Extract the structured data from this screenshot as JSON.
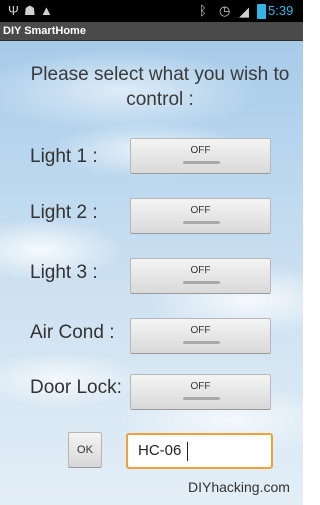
{
  "status_bar": {
    "icons": [
      "usb-icon",
      "android-debug-icon",
      "warning-icon",
      "bluetooth-icon",
      "alarm-icon",
      "signal-icon",
      "battery-icon"
    ],
    "time": "5:39",
    "accent_color": "#33b5e5"
  },
  "app": {
    "title": "DIY SmartHome"
  },
  "prompt": "Please select what you wish to control :",
  "devices": [
    {
      "label": "Light 1 :",
      "state": "OFF"
    },
    {
      "label": "Light 2 :",
      "state": "OFF"
    },
    {
      "label": "Light 3 :",
      "state": "OFF"
    },
    {
      "label": "Air Cond :",
      "state": "OFF"
    },
    {
      "label": "Door Lock:",
      "state": "OFF"
    }
  ],
  "bluetooth": {
    "ok_label": "OK",
    "device_name": "HC-06",
    "field_border_color": "#f0a23a"
  },
  "watermark": "DIYhacking.com"
}
